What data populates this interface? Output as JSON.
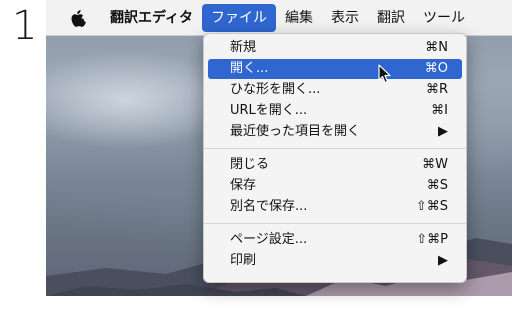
{
  "step_number": "1",
  "menubar": {
    "app_name": "翻訳エディタ",
    "menus": [
      "ファイル",
      "編集",
      "表示",
      "翻訳",
      "ツール"
    ],
    "active_menu": "ファイル"
  },
  "file_menu": {
    "items": [
      {
        "label": "新規",
        "shortcut": "⌘N"
      },
      {
        "label": "開く...",
        "shortcut": "⌘O",
        "highlighted": true
      },
      {
        "label": "ひな形を開く...",
        "shortcut": "⌘R"
      },
      {
        "label": "URLを開く...",
        "shortcut": "⌘I"
      },
      {
        "label": "最近使った項目を開く",
        "shortcut": "▶"
      },
      {
        "label": "閉じる",
        "shortcut": "⌘W"
      },
      {
        "label": "保存",
        "shortcut": "⌘S"
      },
      {
        "label": "別名で保存...",
        "shortcut": "⇧⌘S"
      },
      {
        "label": "ページ設定...",
        "shortcut": "⇧⌘P"
      },
      {
        "label": "印刷",
        "shortcut": "▶"
      }
    ]
  },
  "colors": {
    "highlight": "#2f66d0",
    "menubar_bg": "#f2f2f3",
    "menu_bg": "#f4f4f5"
  }
}
